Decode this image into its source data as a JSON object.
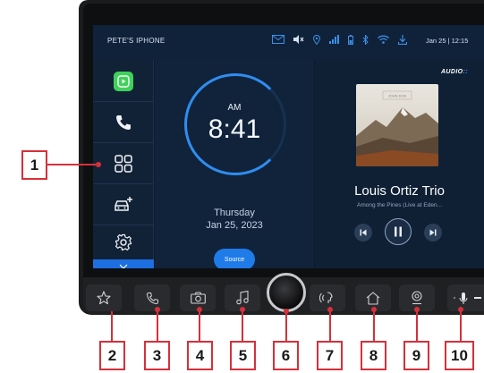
{
  "status_bar": {
    "device_name": "PETE'S IPHONE",
    "icons": [
      "mail-icon",
      "mute-icon",
      "location-icon",
      "signal-icon",
      "battery-icon",
      "bluetooth-icon",
      "wifi-icon",
      "download-icon"
    ],
    "date_time": "Jan 25 | 12:15"
  },
  "sidebar": {
    "items": [
      {
        "icon": "carplay-icon"
      },
      {
        "icon": "phone-icon"
      },
      {
        "icon": "apps-grid-icon"
      },
      {
        "icon": "car-add-icon"
      },
      {
        "icon": "settings-gear-icon"
      }
    ]
  },
  "clock": {
    "period": "AM",
    "time": "8:41",
    "day": "Thursday",
    "date": "Jan 25, 2023",
    "source_label": "Source"
  },
  "media": {
    "brand": "AUDIO",
    "album_caption": "JOHN DOE",
    "artist": "Louis Ortiz Trio",
    "track": "Among the Pines (Live at Eden...",
    "controls": [
      "previous-icon",
      "pause-icon",
      "next-icon"
    ]
  },
  "hardware_buttons": [
    {
      "icon": "star-icon"
    },
    {
      "icon": "phone-icon"
    },
    {
      "icon": "camera-icon"
    },
    {
      "icon": "music-icon"
    },
    {
      "icon": "volume-knob"
    },
    {
      "icon": "voice-icon"
    },
    {
      "icon": "home-icon"
    },
    {
      "icon": "navigation-icon"
    },
    {
      "icon": "microphone-icon"
    }
  ],
  "callouts": {
    "c1": "1",
    "c2": "2",
    "c3": "3",
    "c4": "4",
    "c5": "5",
    "c6": "6",
    "c7": "7",
    "c8": "8",
    "c9": "9",
    "c10": "10"
  },
  "colors": {
    "accent": "#1f7be8",
    "callout": "#d6303a",
    "carplay": "#3fd15a"
  }
}
